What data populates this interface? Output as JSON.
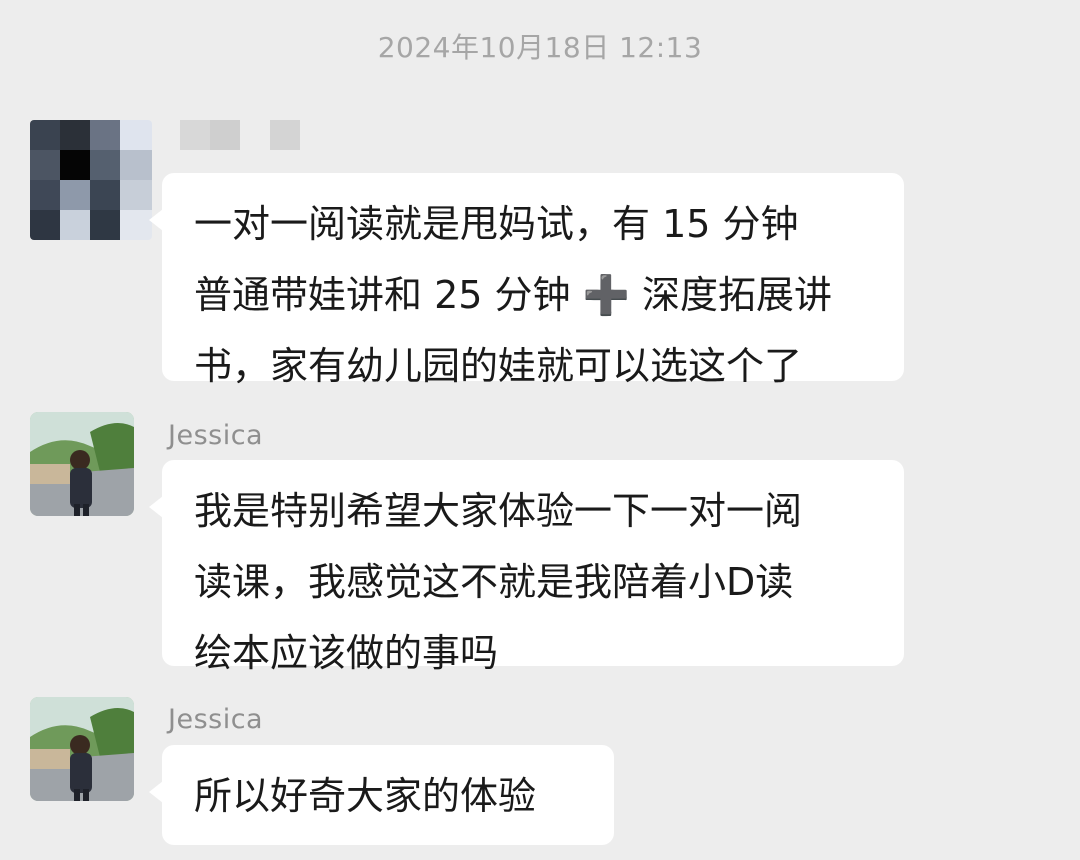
{
  "timestamp": "2024年10月18日 12:13",
  "messages": [
    {
      "sender": "",
      "lines": [
        "一对一阅读就是甩妈试，有 15 分钟",
        "普通带娃讲和 25 分钟 ➕ 深度拓展讲",
        "书，家有幼儿园的娃就可以选这个了"
      ]
    },
    {
      "sender": "Jessica",
      "lines": [
        "我是特别希望大家体验一下一对一阅",
        "读课，我感觉这不就是我陪着小D读",
        "绘本应该做的事吗"
      ]
    },
    {
      "sender": "Jessica",
      "lines": [
        "所以好奇大家的体验"
      ]
    }
  ],
  "colors": {
    "background": "#ededed",
    "bubble": "#ffffff",
    "timestamp": "#a6a6a6",
    "name": "#8f8f8f"
  }
}
